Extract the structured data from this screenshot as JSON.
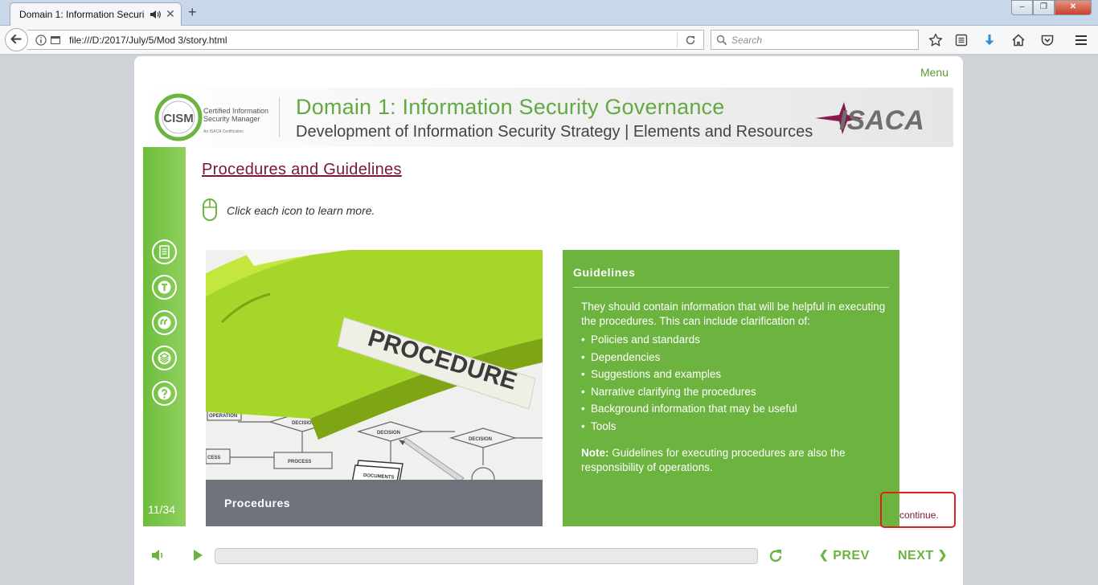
{
  "browser": {
    "tab_title": "Domain 1: Information Securi",
    "url": "file:///D:/2017/July/5/Mod 3/story.html",
    "search_placeholder": "Search",
    "window_buttons": {
      "min": "‒",
      "max": "❐",
      "close": "✕"
    },
    "new_tab": "+",
    "tab_close": "✕"
  },
  "player": {
    "menu_label": "Menu",
    "banner": {
      "cism_mark": "CISM",
      "cism_tagline": "Certified Information Security Manager",
      "cism_sub": "An ISACA Certification",
      "title": "Domain 1: Information Security Governance",
      "subtitle": "Development of Information Security Strategy | Elements and Resources",
      "isaca_logo": "ISACA"
    },
    "sidebar": {
      "icons": [
        "notes-icon",
        "transcript-icon",
        "quote-icon",
        "resources-icon",
        "help-icon"
      ],
      "slide_number": "11/34"
    },
    "slide": {
      "title": "Procedures and Guidelines",
      "instruction": "Click each icon to learn more.",
      "photo_label": "PROCEDURE",
      "photo_caption": "Procedures",
      "panel": {
        "title": "Guidelines",
        "intro": "They should contain information that will be helpful in executing the procedures. This can include clarification of:",
        "items": [
          "Policies and standards",
          "Dependencies",
          "Suggestions and examples",
          "Narrative clarifying the procedures",
          "Background information that may be useful",
          "Tools"
        ],
        "note_label": "Note:",
        "note_text": " Guidelines for executing procedures are also the responsibility of operations."
      },
      "continue_label": "continue."
    },
    "controls": {
      "prev_label": "PREV",
      "next_label": "NEXT",
      "progress": 0
    }
  },
  "colors": {
    "accent_green": "#6cb33f",
    "title_maroon": "#7a1638",
    "highlight_red": "#e02020"
  }
}
